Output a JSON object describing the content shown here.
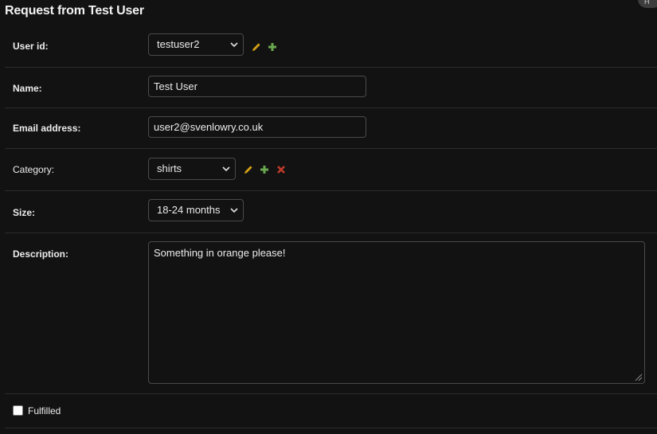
{
  "header": {
    "title": "Request from Test User",
    "corner_button_label": "H"
  },
  "form": {
    "user_id": {
      "label": "User id:",
      "value": "testuser2"
    },
    "name": {
      "label": "Name:",
      "value": "Test User"
    },
    "email": {
      "label": "Email address:",
      "value": "user2@svenlowry.co.uk"
    },
    "category": {
      "label": "Category:",
      "value": "shirts"
    },
    "size": {
      "label": "Size:",
      "value": "18-24 months"
    },
    "description": {
      "label": "Description:",
      "value": "Something in orange please!"
    },
    "fulfilled": {
      "label": "Fulfilled",
      "checked": false
    }
  },
  "icons": {
    "edit": "pencil-icon",
    "add": "plus-icon",
    "delete": "x-icon"
  },
  "colors": {
    "background": "#121212",
    "edit": "#d4a017",
    "add": "#6aa84f",
    "delete": "#c0392b"
  }
}
